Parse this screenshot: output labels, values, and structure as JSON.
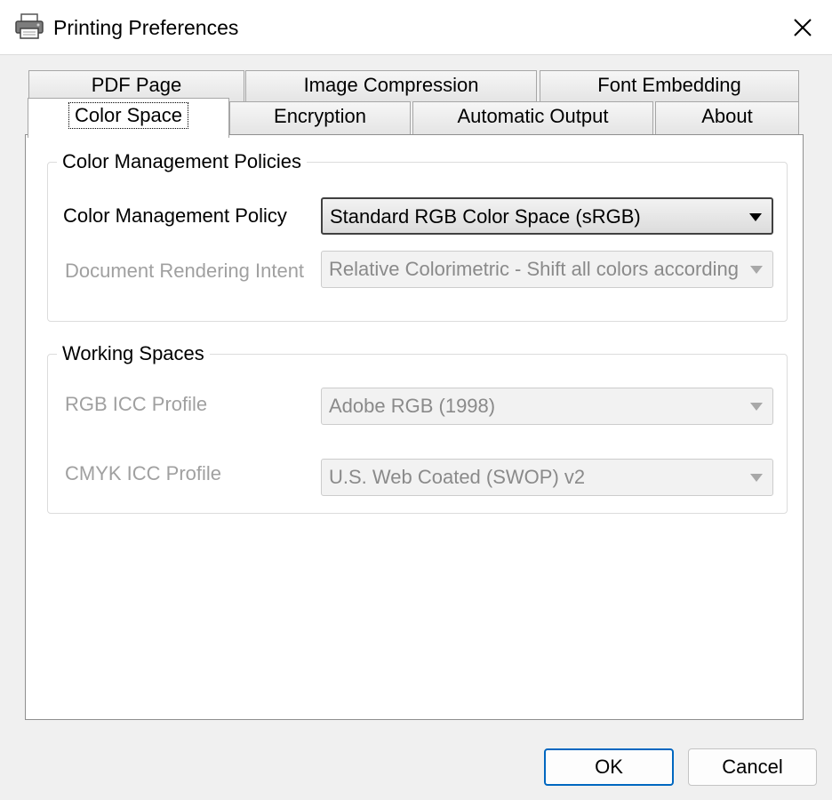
{
  "window": {
    "title": "Printing Preferences",
    "icon": "printer-icon",
    "close_icon": "close-icon"
  },
  "tabs": {
    "row1": [
      {
        "label": "PDF Page"
      },
      {
        "label": "Image Compression"
      },
      {
        "label": "Font Embedding"
      }
    ],
    "row2": [
      {
        "label": "Color Space",
        "active": true
      },
      {
        "label": "Encryption"
      },
      {
        "label": "Automatic Output"
      },
      {
        "label": "About"
      }
    ]
  },
  "color_management": {
    "group_title": "Color Management Policies",
    "policy_label": "Color Management Policy",
    "policy_value": "Standard RGB Color Space (sRGB)",
    "intent_label": "Document Rendering Intent",
    "intent_value": "Relative Colorimetric - Shift all colors accordingly and"
  },
  "working_spaces": {
    "group_title": "Working Spaces",
    "rgb_label": "RGB ICC Profile",
    "rgb_value": "Adobe RGB (1998)",
    "cmyk_label": "CMYK ICC Profile",
    "cmyk_value": "U.S. Web Coated (SWOP) v2"
  },
  "buttons": {
    "ok": "OK",
    "cancel": "Cancel"
  },
  "colors": {
    "default_button_border": "#0067c0",
    "disabled_text": "#a0a0a0",
    "dialog_background": "#f0f0f0"
  }
}
